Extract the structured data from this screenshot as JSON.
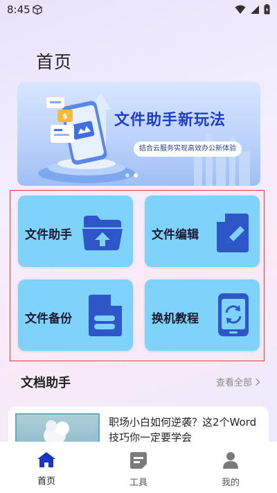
{
  "status": {
    "time": "8:45"
  },
  "page": {
    "title": "首页"
  },
  "banner": {
    "title": "文件助手新玩法",
    "subtitle": "结合云服务实现高效办公新体验"
  },
  "tools": [
    {
      "label": "文件助手",
      "icon": "folder-upload-icon"
    },
    {
      "label": "文件编辑",
      "icon": "document-edit-icon"
    },
    {
      "label": "文件备份",
      "icon": "document-backup-icon"
    },
    {
      "label": "换机教程",
      "icon": "phone-sync-icon"
    }
  ],
  "section": {
    "title": "文档助手",
    "view_all": "查看全部"
  },
  "articles": [
    {
      "title": "职场小白如何逆袭？这2个Word技巧你一定要学会"
    }
  ],
  "nav": {
    "items": [
      {
        "label": "首页",
        "active": true
      },
      {
        "label": "工具",
        "active": false
      },
      {
        "label": "我的",
        "active": false
      }
    ]
  },
  "colors": {
    "accent": "#1e3cc6",
    "card_bg": "#7fd3fb",
    "icon_blue": "#2f56c9",
    "highlight": "#e53935"
  }
}
